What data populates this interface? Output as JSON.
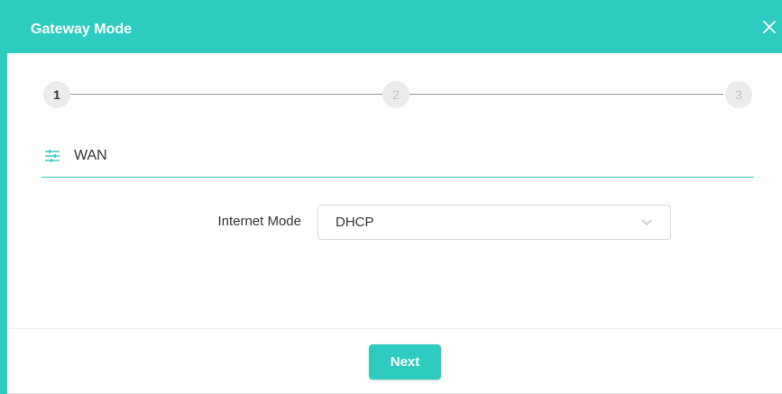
{
  "dialog": {
    "title": "Gateway Mode",
    "close_icon": "close-icon"
  },
  "stepper": {
    "steps": [
      {
        "label": "1",
        "state": "active"
      },
      {
        "label": "2",
        "state": "inactive"
      },
      {
        "label": "3",
        "state": "inactive"
      }
    ]
  },
  "section": {
    "icon": "sliders-icon",
    "label": "WAN"
  },
  "form": {
    "internet_mode_label": "Internet Mode",
    "internet_mode_value": "DHCP",
    "dropdown_icon": "chevron-down-icon"
  },
  "footer": {
    "next_label": "Next"
  },
  "colors": {
    "accent": "#2ecbc0",
    "step_bg": "#ececec",
    "text": "#333333"
  }
}
